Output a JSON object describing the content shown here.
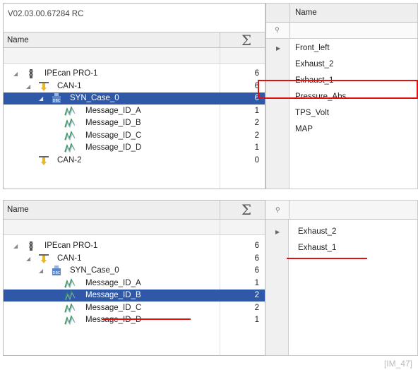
{
  "top_panel": {
    "version": "V02.03.00.67284 RC",
    "tree_header": {
      "name_label": "Name",
      "sum_symbol": "Σ"
    },
    "tree_rows": [
      {
        "label": "IPEcan PRO-1",
        "count": "6",
        "icon": "device-icon",
        "selected": false
      },
      {
        "label": "CAN-1",
        "count": "6",
        "icon": "can-bus-icon",
        "selected": false
      },
      {
        "label": "SYN_Case_0",
        "count": "6",
        "icon": "dbc-file-icon",
        "selected": true
      },
      {
        "label": "Message_ID_A",
        "count": "1",
        "icon": "message-icon",
        "selected": false
      },
      {
        "label": "Message_ID_B",
        "count": "2",
        "icon": "message-icon",
        "selected": false
      },
      {
        "label": "Message_ID_C",
        "count": "2",
        "icon": "message-icon",
        "selected": false
      },
      {
        "label": "Message_ID_D",
        "count": "1",
        "icon": "message-icon",
        "selected": false
      },
      {
        "label": "CAN-2",
        "count": "0",
        "icon": "can-bus-icon",
        "selected": false
      }
    ],
    "signal_header": {
      "name_label": "Name"
    },
    "signals": [
      "Front_left",
      "Exhaust_2",
      "Exhaust_1",
      "Pressure_Abs",
      "TPS_Volt",
      "MAP"
    ]
  },
  "bottom_panel": {
    "tree_header": {
      "name_label": "Name",
      "sum_symbol": "Σ"
    },
    "tree_rows": [
      {
        "label": "IPEcan PRO-1",
        "count": "6",
        "icon": "device-icon",
        "selected": false
      },
      {
        "label": "CAN-1",
        "count": "6",
        "icon": "can-bus-icon",
        "selected": false
      },
      {
        "label": "SYN_Case_0",
        "count": "6",
        "icon": "dbc-file-icon",
        "selected": false
      },
      {
        "label": "Message_ID_A",
        "count": "1",
        "icon": "message-icon",
        "selected": false
      },
      {
        "label": "Message_ID_B",
        "count": "2",
        "icon": "message-icon",
        "selected": true
      },
      {
        "label": "Message_ID_C",
        "count": "2",
        "icon": "message-icon",
        "selected": false
      },
      {
        "label": "Message_ID_D",
        "count": "1",
        "icon": "message-icon",
        "selected": false
      }
    ],
    "signals": [
      "Exhaust_2",
      "Exhaust_1"
    ]
  },
  "watermark": "[IM_47]",
  "colors": {
    "selection": "#2f59a8",
    "highlight": "#e01010"
  }
}
